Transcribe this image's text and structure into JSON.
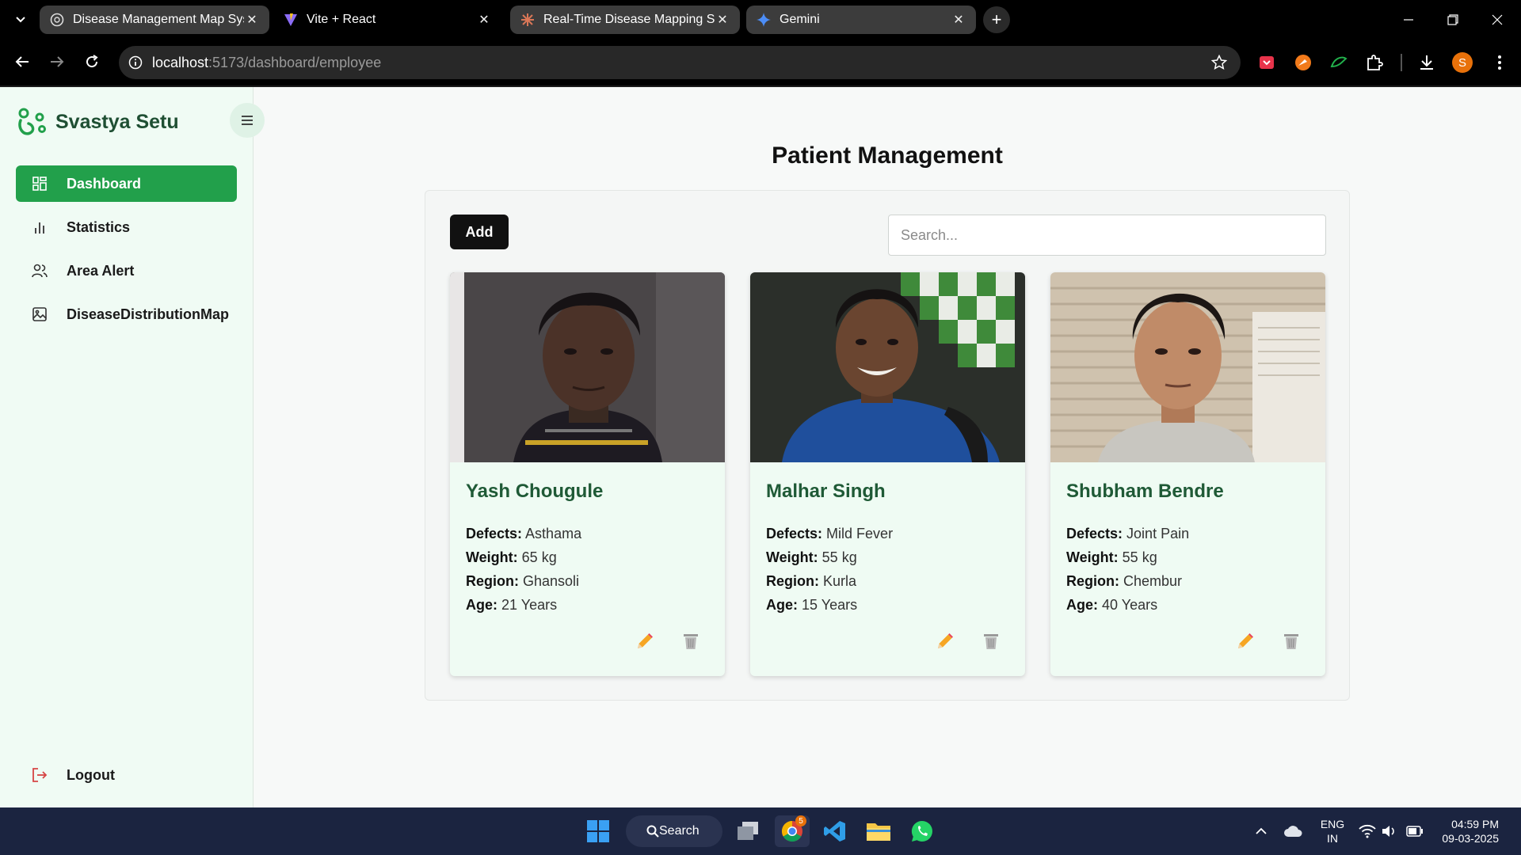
{
  "browser": {
    "tabs": [
      {
        "title": "Disease Management Map Syst",
        "icon": "globe-icon",
        "active": true
      },
      {
        "title": "Vite + React",
        "icon": "vite-icon",
        "active": false
      },
      {
        "title": "Real-Time Disease Mapping Sys",
        "icon": "claude-icon",
        "active": true
      },
      {
        "title": "Gemini",
        "icon": "gemini-icon",
        "active": true
      }
    ],
    "url_host": "localhost",
    "url_path": ":5173/dashboard/employee",
    "profile_initial": "S"
  },
  "sidebar": {
    "brand": "Svastya Setu",
    "items": [
      {
        "label": "Dashboard",
        "icon": "grid-icon",
        "active": true
      },
      {
        "label": "Statistics",
        "icon": "bar-chart-icon",
        "active": false
      },
      {
        "label": "Area Alert",
        "icon": "users-icon",
        "active": false
      },
      {
        "label": "DiseaseDistributionMap",
        "icon": "image-icon",
        "active": false
      }
    ],
    "logout_label": "Logout"
  },
  "main": {
    "title": "Patient Management",
    "add_label": "Add",
    "search_placeholder": "Search...",
    "field_labels": {
      "defects": "Defects:",
      "weight": "Weight:",
      "region": "Region:",
      "age": "Age:"
    },
    "patients": [
      {
        "name": "Yash Chougule",
        "defects": "Asthama",
        "weight": "65 kg",
        "region": "Ghansoli",
        "age": "21 Years"
      },
      {
        "name": "Malhar Singh",
        "defects": "Mild Fever",
        "weight": "55 kg",
        "region": "Kurla",
        "age": "15 Years"
      },
      {
        "name": "Shubham Bendre",
        "defects": "Joint Pain",
        "weight": "55 kg",
        "region": "Chembur",
        "age": "40 Years"
      }
    ]
  },
  "taskbar": {
    "search_label": "Search",
    "chrome_badge": "5",
    "lang_top": "ENG",
    "lang_bottom": "IN",
    "time": "04:59 PM",
    "date": "09-03-2025"
  },
  "colors": {
    "accent": "#22a04b",
    "brand_text": "#1f4f33",
    "sidebar_bg": "#f0fbf4",
    "card_bg": "#effbf3",
    "logout_icon": "#d64545"
  }
}
